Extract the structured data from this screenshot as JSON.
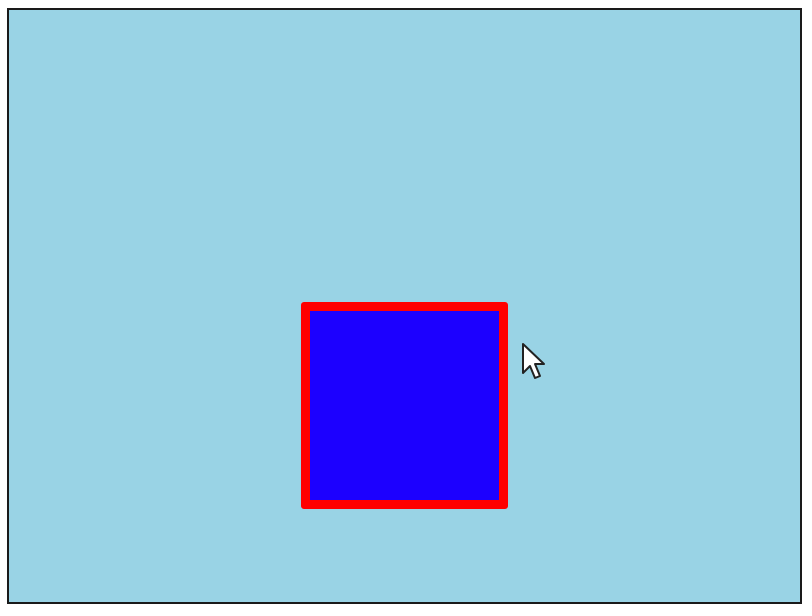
{
  "canvas": {
    "background_color": "#99D3E5",
    "border_color": "#1a1a1a"
  },
  "square": {
    "fill_color": "#1C00FF",
    "border_color": "#FF0000"
  },
  "cursor": {
    "icon": "mouse-pointer-arrow-icon",
    "fill_color": "#ffffff",
    "outline_color": "#222222"
  }
}
